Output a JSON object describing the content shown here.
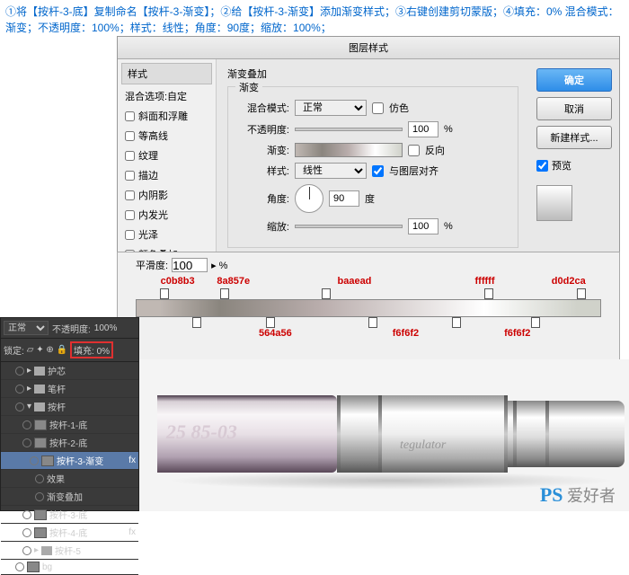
{
  "instructions": "①将【按杆-3-底】复制命名【按杆-3-渐变】；②给【按杆-3-渐变】添加渐变样式；③右键创建剪切蒙版；④填充：0% 混合模式：渐变；不透明度：100%；样式：线性；角度：90度；缩放：100%；",
  "dialog": {
    "title": "图层样式",
    "styles_header": "样式",
    "blend_opts": "混合选项:自定",
    "style_items": [
      "斜面和浮雕",
      "等高线",
      "纹理",
      "描边",
      "内阴影",
      "内发光",
      "光泽",
      "颜色叠加"
    ],
    "section": "渐变叠加",
    "group": "渐变",
    "blend_mode_label": "混合模式:",
    "blend_mode_value": "正常",
    "dither_label": "仿色",
    "opacity_label": "不透明度:",
    "opacity_value": "100",
    "gradient_label": "渐变:",
    "reverse_label": "反向",
    "style_label": "样式:",
    "style_value": "线性",
    "align_label": "与图层对齐",
    "angle_label": "角度:",
    "angle_value": "90",
    "angle_unit": "度",
    "scale_label": "缩放:",
    "scale_value": "100",
    "percent": "%",
    "btn_ok": "确定",
    "btn_cancel": "取消",
    "btn_new": "新建样式...",
    "preview_label": "预览"
  },
  "gradient_editor": {
    "smoothness_label": "平滑度:",
    "smoothness_value": "100",
    "top_labels": [
      {
        "pos": "9%",
        "text": "c0b8b3"
      },
      {
        "pos": "21%",
        "text": "8a857e"
      },
      {
        "pos": "47%",
        "text": "baaead"
      },
      {
        "pos": "75%",
        "text": "ffffff"
      },
      {
        "pos": "93%",
        "text": "d0d2ca"
      }
    ],
    "bot_labels": [
      {
        "pos": "30%",
        "text": "564a56"
      },
      {
        "pos": "58%",
        "text": "f6f6f2"
      },
      {
        "pos": "82%",
        "text": "f6f6f2"
      }
    ],
    "stop_positions_top": [
      "5%",
      "18%",
      "40%",
      "75%",
      "95%"
    ],
    "stop_positions_bot": [
      "12%",
      "28%",
      "50%",
      "68%",
      "85%"
    ]
  },
  "layers": {
    "mode": "正常",
    "opacity_label": "不透明度:",
    "opacity": "100%",
    "lock_label": "锁定:",
    "fill_label": "填充:",
    "fill_value": "0%",
    "items": [
      {
        "name": "护芯",
        "type": "folder",
        "indent": 0
      },
      {
        "name": "笔杆",
        "type": "folder",
        "indent": 0
      },
      {
        "name": "按杆",
        "type": "folder",
        "indent": 0,
        "open": true
      },
      {
        "name": "按杆-1-底",
        "type": "layer",
        "indent": 1
      },
      {
        "name": "按杆-2-底",
        "type": "layer",
        "indent": 1
      },
      {
        "name": "按杆-3-渐变",
        "type": "layer",
        "indent": 2,
        "sel": true,
        "fx": "fx"
      },
      {
        "name": "效果",
        "type": "fx",
        "indent": 3
      },
      {
        "name": "渐变叠加",
        "type": "fx",
        "indent": 3
      },
      {
        "name": "按杆-3-底",
        "type": "layer",
        "indent": 1
      },
      {
        "name": "按杆-4-底",
        "type": "layer",
        "indent": 1,
        "fx": "fx"
      },
      {
        "name": "按杆-5",
        "type": "folder",
        "indent": 1
      },
      {
        "name": "bg",
        "type": "layer",
        "indent": 0
      }
    ]
  },
  "render": {
    "text1": "25 85-03",
    "text2": "tegulator"
  },
  "watermark": {
    "ps": "PS",
    "rest": " 爱好者"
  }
}
